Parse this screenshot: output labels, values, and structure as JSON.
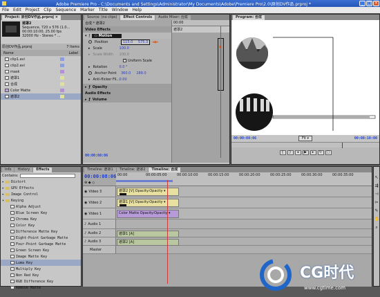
{
  "window": {
    "title": "Adobe Premiere Pro - C:\\Documents and Settings\\Administrator\\My Documents\\Adobe\\Premiere Pro\\2.0\\原创DV作品.prproj *"
  },
  "menu": [
    "File",
    "Edit",
    "Project",
    "Clip",
    "Sequence",
    "Marker",
    "Title",
    "Window",
    "Help"
  ],
  "project": {
    "tab": "Project: 原创DV作品.prproj",
    "tab_x": "×",
    "clip_name": "遮罩2",
    "clip_info": [
      "Sequence, 720 x 576 (1.0...",
      "00:00:10:00, 25.00 fps",
      "32000 Hz - Stereo * ..."
    ],
    "search_label": "原创DV作品.prproj",
    "items_count": "7 Items",
    "columns": [
      "Name",
      "Label"
    ],
    "items": [
      "clip1.avi",
      "clip2.avi",
      "mask",
      "遮罩1",
      "合成",
      "Color Matte",
      "遮罩2"
    ]
  },
  "effects": {
    "tabs": [
      "Info",
      "History",
      "Effects"
    ],
    "search_label": "Contains:",
    "items": [
      "Distort",
      "GPU Effects",
      "Image Control",
      "Keying",
      "Alpha Adjust",
      "Blue Screen Key",
      "Chroma Key",
      "Color Key",
      "Difference Matte Key",
      "Eight-Point Garbage Matte",
      "Four-Point Garbage Matte",
      "Green Screen Key",
      "Image Matte Key",
      "Luma Key",
      "Multiply Key",
      "Non Red Key",
      "RGB Difference Key",
      "Remove Matte"
    ]
  },
  "effect_controls": {
    "tabs": [
      "Source: (no clips)",
      "Effect Controls",
      "Audio Mixer: 合成"
    ],
    "clip_label": "合成 * 遮罩2",
    "ruler_time": "00:00",
    "ruler_clip": "遮罩2",
    "video_effects": "Video Effects",
    "motion": "Motion",
    "position_label": "Position",
    "position_x": "115.0",
    "position_y": "575.3",
    "scale_label": "Scale",
    "scale_val": "100.0",
    "scale_width_label": "Scale Width",
    "scale_width_val": "100.0",
    "uniform_scale": "Uniform Scale",
    "rotation_label": "Rotation",
    "rotation_val": "0.0 °",
    "anchor_label": "Anchor Point",
    "anchor_x": "360.0",
    "anchor_y": "288.0",
    "antiflicker_label": "Anti-flicker Fil...",
    "antiflicker_val": "0.00",
    "opacity": "Opacity",
    "audio_effects": "Audio Effects",
    "volume": "Volume",
    "timecode": "00:00:08:06"
  },
  "program": {
    "tab": "Program: 合成",
    "timecode": "00:00:08:06",
    "fit": "Fit",
    "duration": "00:00:10:00"
  },
  "timeline": {
    "tabs": [
      "Timeline: 遮罩1",
      "Timeline: 遮罩2",
      "Timeline: 合成"
    ],
    "timecode": "00:00:08:06",
    "ruler": [
      "00:00",
      "00:00:05:00",
      "00:00:10:00",
      "00:00:15:00",
      "00:00:20:00",
      "00:00:25:00",
      "00:00:30:00",
      "00:00:35:00"
    ],
    "tracks": [
      {
        "name": "Video 3",
        "clip": "遮罩2 [V] Opacity:Opacity ▾"
      },
      {
        "name": "Video 2",
        "clip": "遮罩1 [V] Opacity:Opacity ▾"
      },
      {
        "name": "Video 1",
        "clip": "Color Matte Opacity:Opacity ▾"
      },
      {
        "name": "Audio 1",
        "clip": ""
      },
      {
        "name": "Audio 2",
        "clip": "遮罩1 [A]"
      },
      {
        "name": "Audio 3",
        "clip": "遮罩2 [A]"
      },
      {
        "name": "Master",
        "clip": ""
      }
    ]
  },
  "watermark": {
    "brand": "CG时代",
    "url": "www.cgtime.com"
  }
}
